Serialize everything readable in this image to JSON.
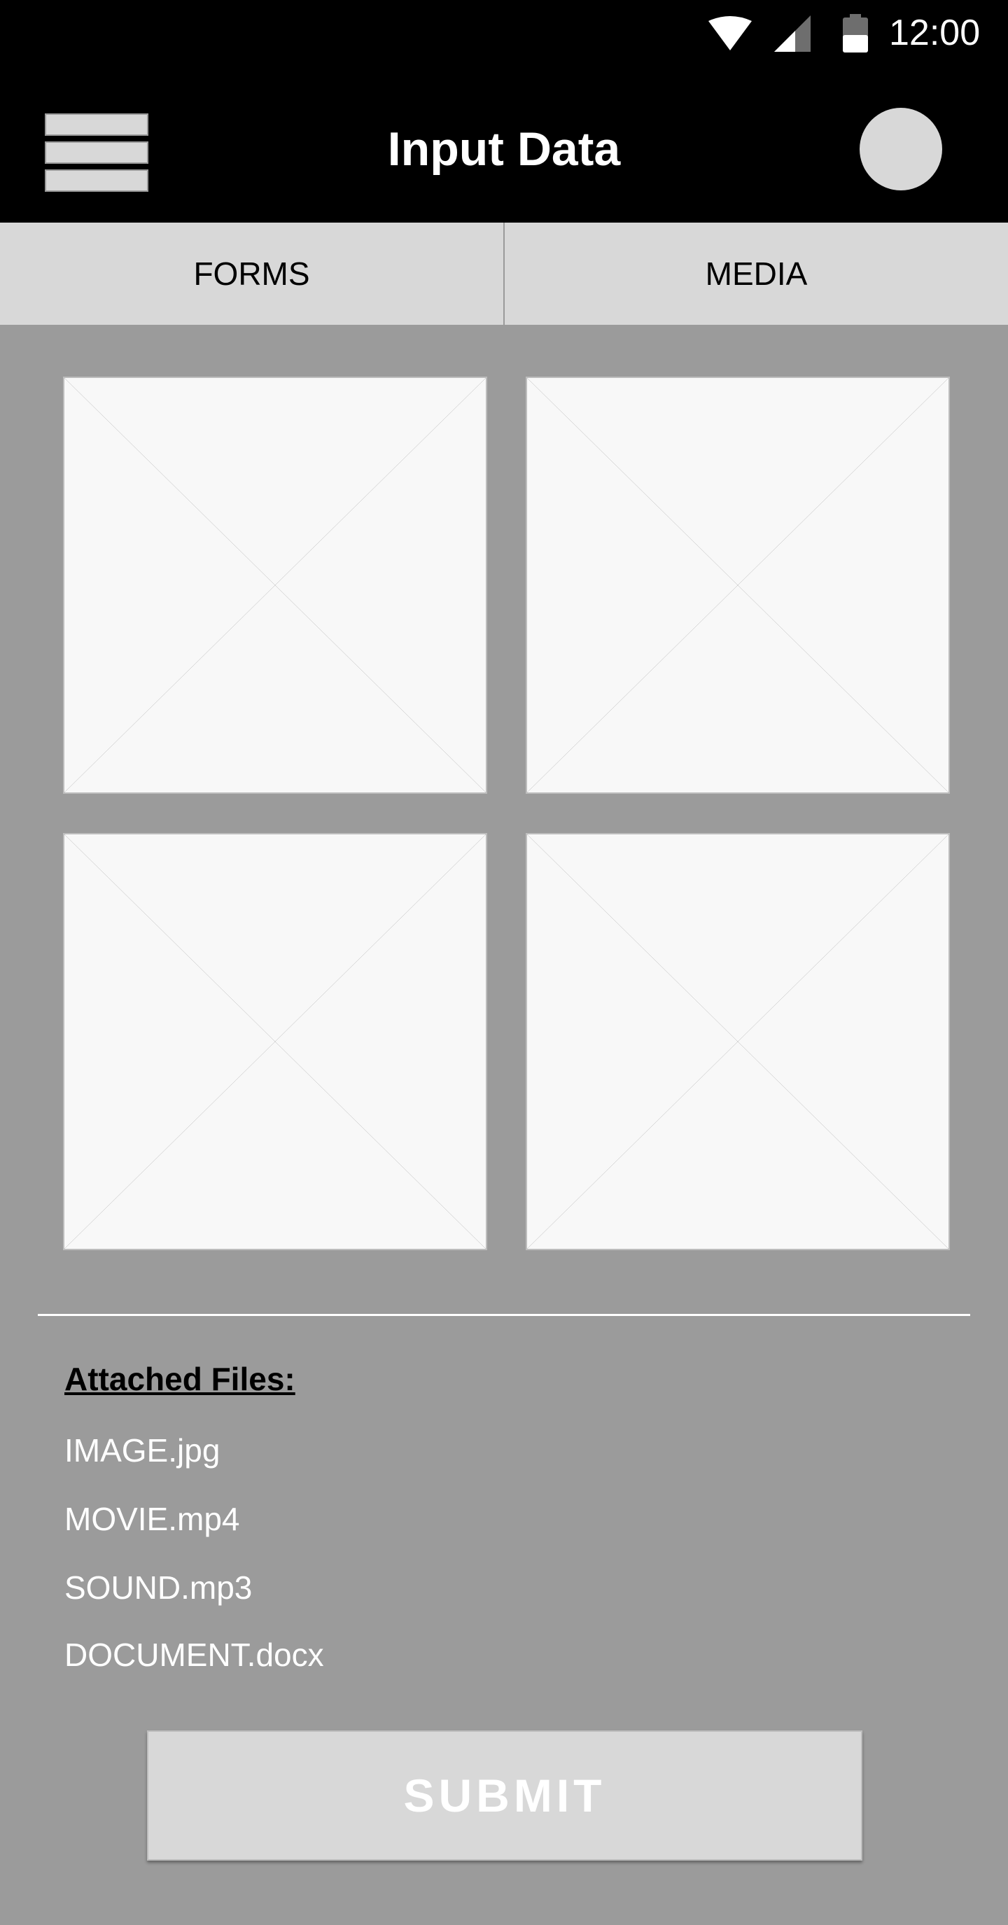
{
  "status_bar": {
    "time": "12:00",
    "icons": [
      "wifi-icon",
      "cell-signal-icon",
      "battery-icon"
    ]
  },
  "app_bar": {
    "title": "Input Data",
    "menu_icon": "hamburger-menu-icon",
    "avatar": "avatar"
  },
  "tabs": [
    {
      "label": "FORMS"
    },
    {
      "label": "MEDIA"
    }
  ],
  "media": {
    "thumbnails": [
      {
        "icon": "image-placeholder"
      },
      {
        "icon": "image-placeholder"
      },
      {
        "icon": "image-placeholder"
      },
      {
        "icon": "image-placeholder"
      }
    ]
  },
  "attachments": {
    "heading": "Attached Files:",
    "files": [
      {
        "name": "IMAGE.jpg"
      },
      {
        "name": "MOVIE.mp4"
      },
      {
        "name": "SOUND.mp3"
      },
      {
        "name": "DOCUMENT.docx"
      }
    ]
  },
  "actions": {
    "submit_label": "SUBMIT"
  },
  "colors": {
    "bar_background": "#000000",
    "page_background": "#9b9b9b",
    "tab_background": "#d8d8d8",
    "placeholder_fill": "#f8f8f8"
  }
}
